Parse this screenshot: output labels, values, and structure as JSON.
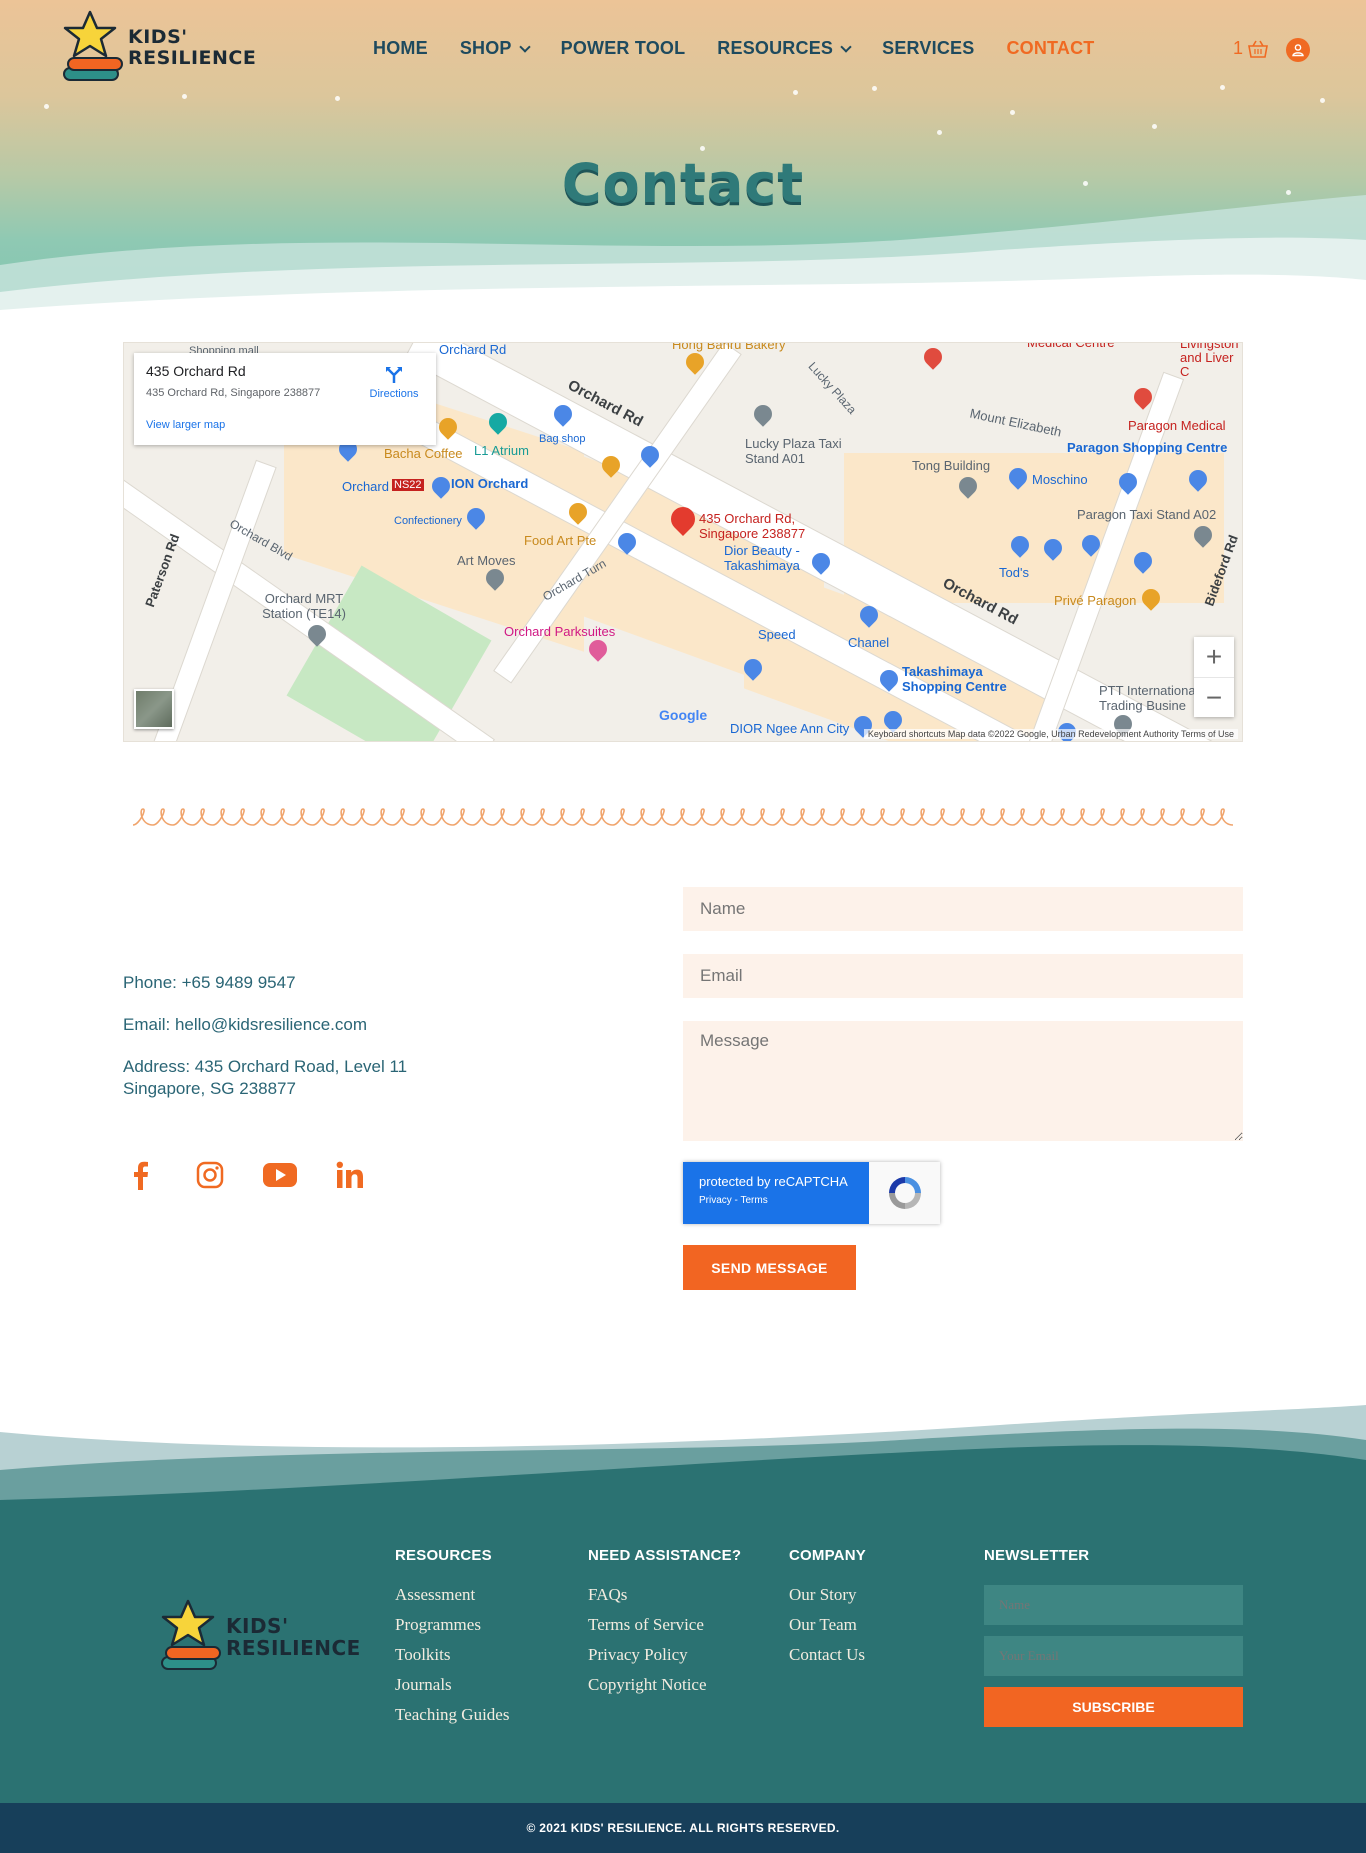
{
  "brand": {
    "line1": "KIDS'",
    "line2": "RESILIENCE",
    "accent": "#f06a22",
    "teal": "#2b7272",
    "navy": "#173f5a"
  },
  "nav": {
    "items": [
      {
        "label": "HOME"
      },
      {
        "label": "SHOP",
        "dropdown": true
      },
      {
        "label": "POWER TOOL"
      },
      {
        "label": "RESOURCES",
        "dropdown": true
      },
      {
        "label": "SERVICES"
      },
      {
        "label": "CONTACT",
        "active": true
      }
    ],
    "cart_count": "1",
    "cart_icon": "basket-icon",
    "user_icon": "user-icon"
  },
  "hero": {
    "title": "Contact"
  },
  "map": {
    "card_title": "435 Orchard Rd",
    "card_address": "435 Orchard Rd, Singapore 238877",
    "directions": "Directions",
    "larger_map": "View larger map",
    "marker_line1": "435 Orchard Rd,",
    "marker_line2": "Singapore 238877",
    "footer_text": "Keyboard shortcuts   Map data ©2022 Google, Urban Redevelopment Authority   Terms of Use",
    "google": "Google",
    "labels": {
      "orchard_rd_a": "Orchard Rd",
      "orchard_rd_b": "Orchard Rd",
      "orchard_blvd": "Orchard Blvd",
      "paterson_rd": "Paterson Rd",
      "lucky_plaza": "Lucky Plaza",
      "lucky_plaza_taxi": "Lucky Plaza Taxi Stand A01",
      "mount_elizabeth": "Mount Elizabeth",
      "paragon_sc": "Paragon Shopping Centre",
      "paragon_medical": "Paragon Medical",
      "tong_building": "Tong Building",
      "moschino": "Moschino",
      "paragon_taxi": "Paragon Taxi Stand A02",
      "bacha_coffee": "Bacha Coffee",
      "l1_atrium": "L1 Atrium",
      "bag_shop": "Bag shop",
      "ion_orchard": "ION Orchard",
      "orchard": "Orchard",
      "ns22": "NS22",
      "confectionery": "Confectionery",
      "food_art": "Food Art Pte",
      "dior_beauty": "Dior Beauty - Takashimaya",
      "art_moves": "Art Moves",
      "orchard_turn": "Orchard Turn",
      "orchard_mrt": "Orchard MRT Station (TE14)",
      "orchard_parksuites": "Orchard Parksuites",
      "speed": "Speed",
      "chanel": "Chanel",
      "takashimaya": "Takashimaya Shopping Centre",
      "tods": "Tod's",
      "prive_paragon": "Privé Paragon",
      "bideford_rd": "Bideford Rd",
      "ptt": "PTT International Trading Busine",
      "dior_ngee": "DIOR Ngee Ann City",
      "hong_bakery": "Hong Bahru Bakery",
      "medical_centre": "Medical Centre",
      "livingston": "Livingston and Liver C"
    }
  },
  "contact": {
    "phone": "Phone: +65 9489 9547",
    "email": "Email: hello@kidsresilience.com",
    "address_line1": "Address: 435 Orchard Road, Level 11",
    "address_line2": "Singapore, SG 238877",
    "socials": [
      "facebook-icon",
      "instagram-icon",
      "youtube-icon",
      "linkedin-icon"
    ]
  },
  "form": {
    "name_placeholder": "Name",
    "email_placeholder": "Email",
    "message_placeholder": "Message",
    "recaptcha_line1": "protected by reCAPTCHA",
    "recaptcha_line2": "Privacy - Terms",
    "send_label": "SEND MESSAGE"
  },
  "footer": {
    "resources": {
      "heading": "RESOURCES",
      "links": [
        "Assessment",
        "Programmes",
        "Toolkits",
        "Journals",
        "Teaching Guides"
      ]
    },
    "assistance": {
      "heading": "NEED ASSISTANCE?",
      "links": [
        "FAQs",
        "Terms of Service",
        "Privacy Policy",
        "Copyright Notice"
      ]
    },
    "company": {
      "heading": "COMPANY",
      "links": [
        "Our Story",
        "Our Team",
        "Contact Us"
      ]
    },
    "newsletter": {
      "heading": "NEWSLETTER",
      "name_placeholder": "Name",
      "email_placeholder": "Your Email",
      "subscribe": "SUBSCRIBE"
    },
    "copyright": "© 2021 KIDS' RESILIENCE. ALL RIGHTS RESERVED."
  }
}
